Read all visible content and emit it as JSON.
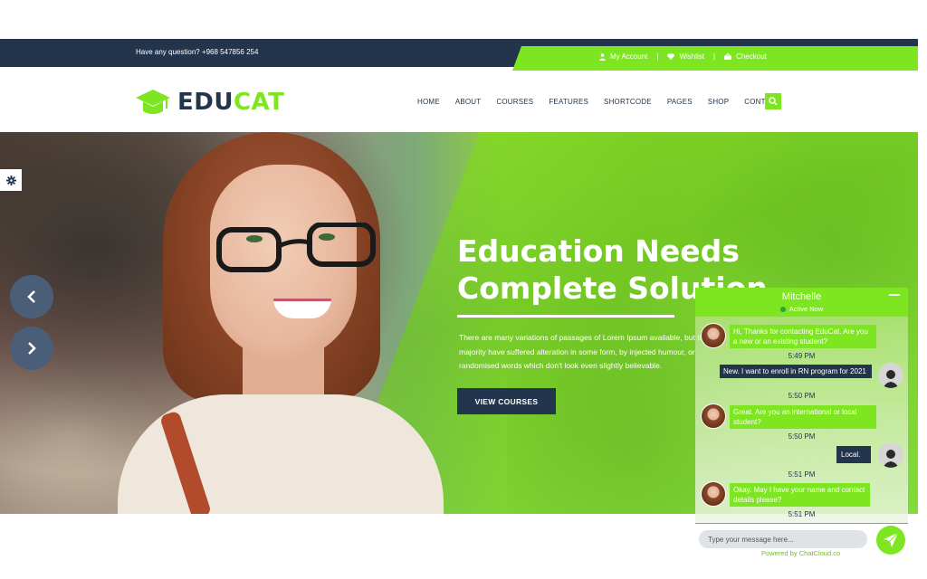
{
  "topbar": {
    "question": "Have any question? +968 547856 254",
    "links": [
      {
        "label": "My Account",
        "icon": "user-icon"
      },
      {
        "label": "Wishlist",
        "icon": "heart-icon"
      },
      {
        "label": "Checkout",
        "icon": "cart-icon"
      }
    ],
    "separator": "|"
  },
  "logo": {
    "part1": "EDU",
    "part2": "CAT",
    "icon": "graduation-cap-icon"
  },
  "nav": [
    "HOME",
    "ABOUT",
    "COURSES",
    "FEATURES",
    "SHORTCODE",
    "PAGES",
    "SHOP",
    "CONTACT"
  ],
  "hero": {
    "title_line1": "Education Needs",
    "title_line2": "Complete Solution",
    "text": "There are many variations of passages of Lorem Ipsum available, but the majority have suffered alteration in some form, by injected humour, or randomised words which don't look even slightly believable.",
    "button": "VIEW COURSES"
  },
  "chat": {
    "agent_name": "Mitchelle",
    "status": "Active Now",
    "messages": [
      {
        "from": "agent",
        "text": "Hi, Thanks for contacting EduCat. Are you a new or an existing student?",
        "time": "5:49 PM"
      },
      {
        "from": "user",
        "text": "New. I want to enroll in RN program for 2021",
        "time": "5:50 PM"
      },
      {
        "from": "agent",
        "text": "Great. Are you an international or local student?",
        "time": "5:50 PM"
      },
      {
        "from": "user",
        "text": "Local.",
        "time": "5:51 PM"
      },
      {
        "from": "agent",
        "text": "Okay. May I have your name and contact details please?",
        "time": "5:51 PM"
      }
    ],
    "input_placeholder": "Type your message here...",
    "powered_by": "Powered by ChatCloud.co"
  },
  "colors": {
    "navy": "#22354d",
    "green": "#7ee620"
  }
}
